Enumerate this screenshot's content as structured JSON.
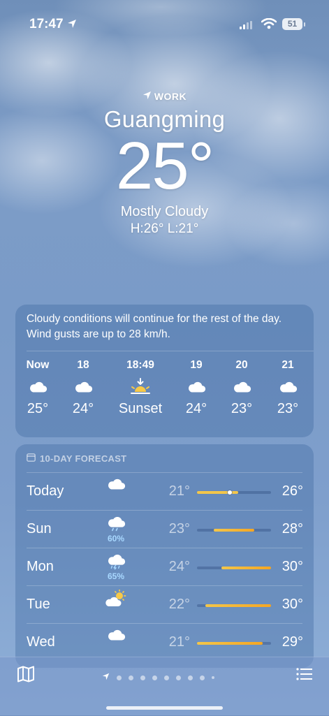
{
  "status_bar": {
    "time": "17:47",
    "battery": "51"
  },
  "header": {
    "location_tag": "WORK",
    "city": "Guangming",
    "temperature": "25°",
    "condition": "Mostly Cloudy",
    "hi_lo": "H:26°  L:21°"
  },
  "hourly": {
    "summary": "Cloudy conditions will continue for the rest of the day. Wind gusts are up to 28 km/h.",
    "hours": [
      {
        "label": "Now",
        "icon": "cloud-icon",
        "value": "25°"
      },
      {
        "label": "18",
        "icon": "cloud-icon",
        "value": "24°"
      },
      {
        "label": "18:49",
        "icon": "sunset-icon",
        "value": "Sunset"
      },
      {
        "label": "19",
        "icon": "cloud-icon",
        "value": "24°"
      },
      {
        "label": "20",
        "icon": "cloud-icon",
        "value": "23°"
      },
      {
        "label": "21",
        "icon": "cloud-icon",
        "value": "23°"
      }
    ]
  },
  "forecast": {
    "title": "10-DAY FORECAST",
    "range_min": 21,
    "range_max": 30,
    "days": [
      {
        "day": "Today",
        "icon": "cloud-icon",
        "precip": "",
        "low": "21°",
        "high": "26°",
        "low_val": 21,
        "high_val": 26,
        "current": 25
      },
      {
        "day": "Sun",
        "icon": "cloud-rain-icon",
        "precip": "60%",
        "low": "23°",
        "high": "28°",
        "low_val": 23,
        "high_val": 28
      },
      {
        "day": "Mon",
        "icon": "cloud-storm-icon",
        "precip": "65%",
        "low": "24°",
        "high": "30°",
        "low_val": 24,
        "high_val": 30
      },
      {
        "day": "Tue",
        "icon": "partly-sunny-icon",
        "precip": "",
        "low": "22°",
        "high": "30°",
        "low_val": 22,
        "high_val": 30
      },
      {
        "day": "Wed",
        "icon": "cloud-icon",
        "precip": "",
        "low": "21°",
        "high": "29°",
        "low_val": 21,
        "high_val": 29
      }
    ]
  },
  "colors": {
    "bar_warm": "#f5a623",
    "bar_mild": "#f3c64a",
    "precip": "#a8d8ff"
  }
}
